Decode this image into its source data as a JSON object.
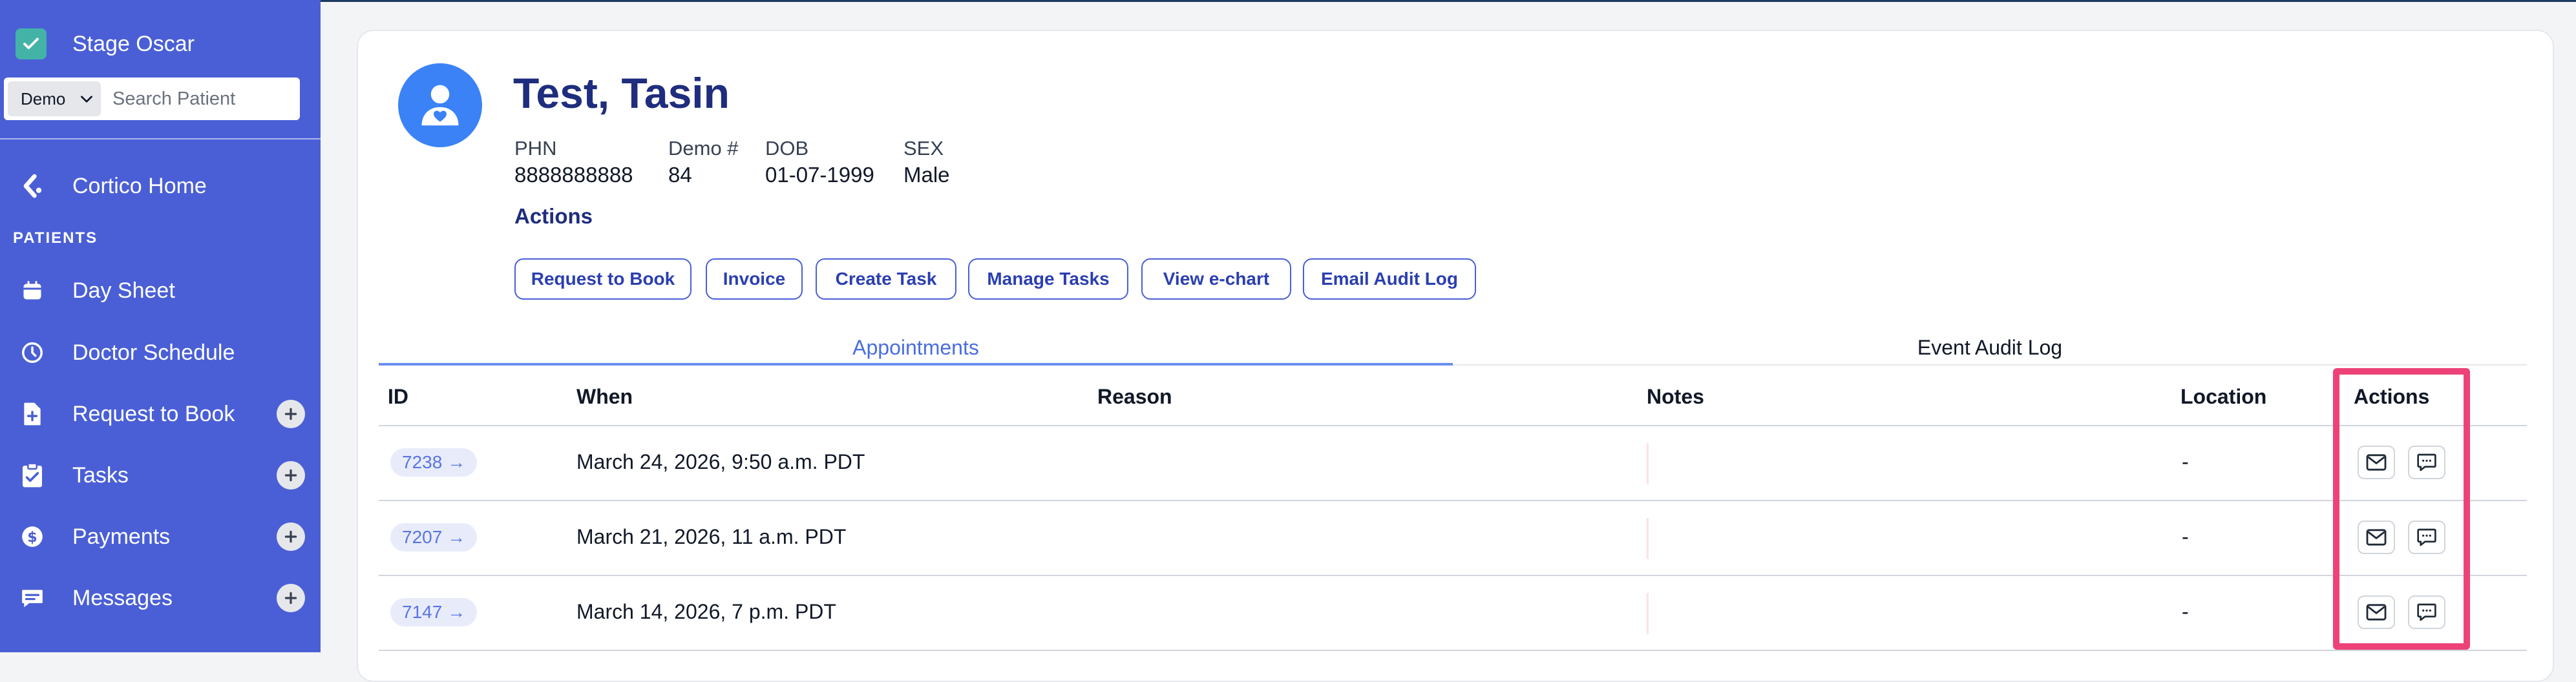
{
  "sidebar": {
    "app_title": "Stage Oscar",
    "demo_select": "Demo",
    "search_placeholder": "Search Patient",
    "home_label": "Cortico Home",
    "section_label": "PATIENTS",
    "items": [
      {
        "label": "Day Sheet",
        "icon": "calendar-icon"
      },
      {
        "label": "Doctor Schedule",
        "icon": "clock-icon"
      },
      {
        "label": "Request to Book",
        "icon": "file-plus-icon",
        "has_add": true
      },
      {
        "label": "Tasks",
        "icon": "clipboard-check-icon",
        "has_add": true
      },
      {
        "label": "Payments",
        "icon": "dollar-icon",
        "has_add": true
      },
      {
        "label": "Messages",
        "icon": "message-icon",
        "has_add": true
      }
    ]
  },
  "patient": {
    "name": "Test, Tasin",
    "fields": [
      {
        "label": "PHN",
        "value": "8888888888"
      },
      {
        "label": "Demo #",
        "value": "84"
      },
      {
        "label": "DOB",
        "value": "01-07-1999"
      },
      {
        "label": "SEX",
        "value": "Male"
      }
    ],
    "actions_title": "Actions",
    "action_buttons": [
      "Request to Book",
      "Invoice",
      "Create Task",
      "Manage Tasks",
      "View e-chart",
      "Email Audit Log"
    ]
  },
  "tabs": [
    {
      "label": "Appointments",
      "active": true
    },
    {
      "label": "Event Audit Log",
      "active": false
    }
  ],
  "table": {
    "headers": [
      "ID",
      "When",
      "Reason",
      "Notes",
      "Location",
      "Actions"
    ],
    "rows": [
      {
        "id": "7238",
        "when": "March 24, 2026, 9:50 a.m. PDT",
        "reason": "",
        "location": "-"
      },
      {
        "id": "7207",
        "when": "March 21, 2026, 11 a.m. PDT",
        "reason": "",
        "location": "-"
      },
      {
        "id": "7147",
        "when": "March 14, 2026, 7 p.m. PDT",
        "reason": "",
        "location": "-"
      }
    ]
  },
  "colors": {
    "sidebar_bg": "#4a5fd6",
    "accent": "#4a6ee0",
    "title_navy": "#1e2d7d",
    "highlight": "#ec4278"
  }
}
